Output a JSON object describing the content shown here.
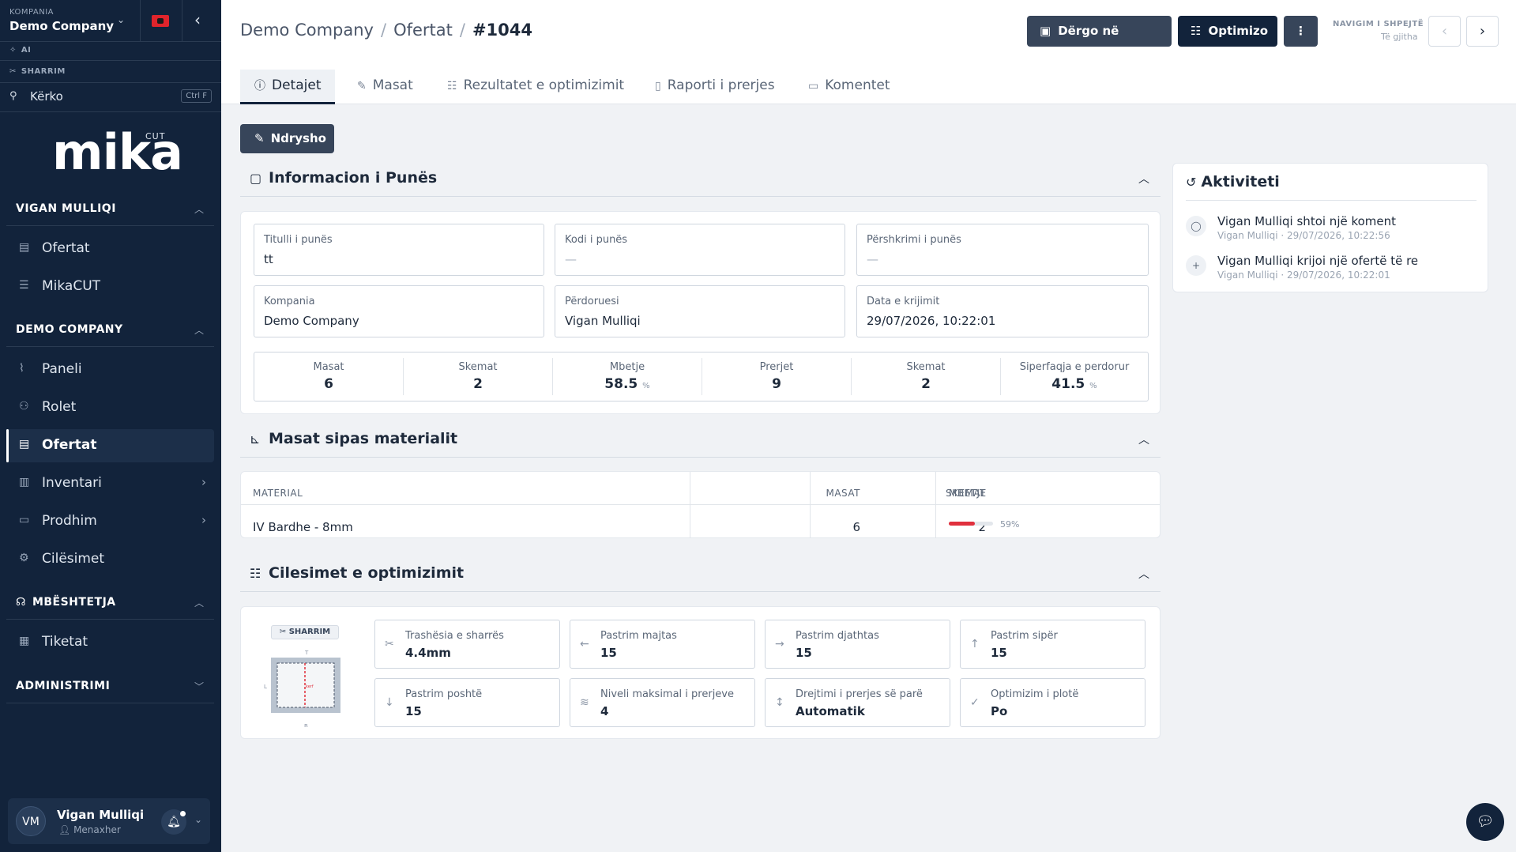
{
  "sidebar": {
    "company_label": "KOMPANIA",
    "company_name": "Demo Company",
    "ai_label": "AI",
    "sawing_label": "SHARRIM",
    "search_placeholder": "Kërko",
    "search_shortcut": "Ctrl F",
    "logo": "mika",
    "logo_sup": "CUT",
    "sections": [
      {
        "title": "VIGAN MULLIQI",
        "items": [
          {
            "label": "Ofertat",
            "icon": "document-icon"
          },
          {
            "label": "MikaCUT",
            "icon": "list-icon"
          }
        ]
      },
      {
        "title": "DEMO COMPANY",
        "items": [
          {
            "label": "Paneli",
            "icon": "chart-icon"
          },
          {
            "label": "Rolet",
            "icon": "people-icon"
          },
          {
            "label": "Ofertat",
            "icon": "document-icon",
            "active": true
          },
          {
            "label": "Inventari",
            "icon": "warehouse-icon"
          },
          {
            "label": "Prodhim",
            "icon": "factory-icon"
          },
          {
            "label": "Cilësimet",
            "icon": "settings-icon"
          }
        ]
      },
      {
        "title": "MBËSHTETJA",
        "items": [
          {
            "label": "Tiketat",
            "icon": "ticket-icon"
          }
        ]
      },
      {
        "title": "ADMINISTRIMI",
        "items": []
      }
    ],
    "user": {
      "initials": "VM",
      "name": "Vigan Mulliqi",
      "role": "Menaxher"
    }
  },
  "header": {
    "breadcrumb": [
      "Demo Company",
      "Ofertat",
      "#1044"
    ],
    "send_button": "Dërgo në makinë",
    "optimize_button": "Optimizo",
    "more_button": "⋮",
    "quick_nav_label": "NAVIGIM I SHPEJTË",
    "quick_nav_value": "Të gjitha"
  },
  "tabs": [
    {
      "label": "Detajet",
      "icon": "info-icon"
    },
    {
      "label": "Masat",
      "icon": "pencil-icon"
    },
    {
      "label": "Rezultatet e optimizimit",
      "icon": "sliders-icon"
    },
    {
      "label": "Raporti i prerjes",
      "icon": "file-icon"
    },
    {
      "label": "Komentet",
      "icon": "comment-icon"
    }
  ],
  "edit_button": "Ndrysho",
  "job_info": {
    "title": "Informacion i Punës",
    "fields": [
      {
        "label": "Titulli i punës",
        "value": "tt"
      },
      {
        "label": "Kodi i punës",
        "value": "—"
      },
      {
        "label": "Përshkrimi i punës",
        "value": "—"
      },
      {
        "label": "Kompania",
        "value": "Demo Company"
      },
      {
        "label": "Përdoruesi",
        "value": "Vigan Mulliqi"
      },
      {
        "label": "Data e krijimit",
        "value": "29/07/2026, 10:22:01"
      }
    ],
    "stats": [
      {
        "label": "Masat",
        "value": "6",
        "unit": ""
      },
      {
        "label": "Skemat",
        "value": "2",
        "unit": ""
      },
      {
        "label": "Mbetje",
        "value": "58.5",
        "unit": "%"
      },
      {
        "label": "Prerjet",
        "value": "9",
        "unit": ""
      },
      {
        "label": "Skemat",
        "value": "2",
        "unit": ""
      },
      {
        "label": "Siperfaqja e perdorur",
        "value": "41.5",
        "unit": "%"
      }
    ]
  },
  "materials": {
    "title": "Masat sipas materialit",
    "headers": [
      "MATERIAL",
      "MASAT",
      "SKEMAT",
      "MBETJE"
    ],
    "rows": [
      {
        "material": "IV Bardhe - 8mm",
        "masat": "6",
        "skemat": "2",
        "mbetje_label": "59%",
        "mbetje_fraction": 0.59
      }
    ],
    "bar_color": "#e0303d"
  },
  "optimization": {
    "title": "Cilesimet e optimizimit",
    "saw_tag": "SHARRIM",
    "diagram": {
      "top": "T",
      "bottom": "B",
      "left": "L",
      "right": "R",
      "center": "kerf"
    },
    "settings": [
      {
        "label": "Trashësia e sharrës",
        "value": "4.4mm",
        "icon": "scissors-icon"
      },
      {
        "label": "Pastrim majtas",
        "value": "15",
        "icon": "arrow-left-icon"
      },
      {
        "label": "Pastrim djathtas",
        "value": "15",
        "icon": "arrow-right-icon"
      },
      {
        "label": "Pastrim sipër",
        "value": "15",
        "icon": "arrow-up-icon"
      },
      {
        "label": "Pastrim poshtë",
        "value": "15",
        "icon": "arrow-down-icon"
      },
      {
        "label": "Niveli maksimal i prerjeve",
        "value": "4",
        "icon": "layers-icon"
      },
      {
        "label": "Drejtimi i prerjes së parë",
        "value": "Automatik",
        "icon": "arrows-vertical-icon"
      },
      {
        "label": "Optimizim i plotë",
        "value": "Po",
        "icon": "check-circle-icon"
      }
    ]
  },
  "activity": {
    "title": "Aktiviteti",
    "items": [
      {
        "text": "Vigan Mulliqi shtoi një koment",
        "meta": "Vigan Mulliqi · 29/07/2026, 10:22:56",
        "icon": "comment-icon"
      },
      {
        "text": "Vigan Mulliqi krijoi një ofertë të re",
        "meta": "Vigan Mulliqi · 29/07/2026, 10:22:01",
        "icon": "plus-icon"
      }
    ]
  },
  "colors": {
    "sidebar_bg": "#12233b",
    "primary_btn": "#12233b",
    "secondary_btn": "#37455a",
    "accent_red": "#e0303d"
  }
}
